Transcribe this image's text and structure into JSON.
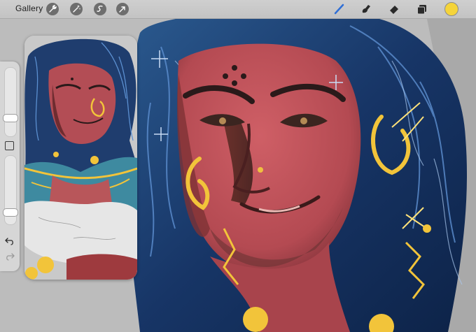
{
  "toolbar": {
    "gallery_label": "Gallery",
    "actions": [
      "wrench-icon",
      "magic-wand-icon",
      "selection-icon",
      "transform-arrow-icon"
    ],
    "tools": [
      "brush-icon",
      "smudge-icon",
      "eraser-icon",
      "layers-icon"
    ],
    "current_color": "#f5d43a"
  },
  "sidebar": {
    "brush_size_level": 0.25,
    "opacity_level": 0.15
  },
  "colors": {
    "hair": "#1e3f6e",
    "skin": "#c0515a",
    "gold": "#f2c43a",
    "canvas_bg": "#b9b9b9"
  }
}
